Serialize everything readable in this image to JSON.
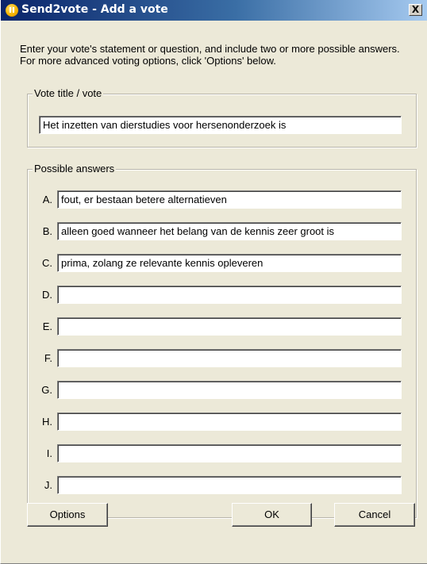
{
  "window": {
    "title": "Send2vote - Add a vote",
    "close_label": "X"
  },
  "intro_text": "Enter your vote's statement or question, and include two or more possible answers. For more advanced voting options, click 'Options' below.",
  "vote_title_group": {
    "legend": "Vote title / vote",
    "value": "Het inzetten van dierstudies voor hersenonderzoek is"
  },
  "answers_group": {
    "legend": "Possible answers",
    "items": [
      {
        "letter": "A.",
        "value": " fout, er bestaan betere alternatieven"
      },
      {
        "letter": "B.",
        "value": "alleen goed wanneer het belang van de kennis zeer groot is"
      },
      {
        "letter": "C.",
        "value": "prima, zolang ze relevante kennis opleveren"
      },
      {
        "letter": "D.",
        "value": ""
      },
      {
        "letter": "E.",
        "value": ""
      },
      {
        "letter": "F.",
        "value": ""
      },
      {
        "letter": "G.",
        "value": ""
      },
      {
        "letter": "H.",
        "value": ""
      },
      {
        "letter": "I.",
        "value": ""
      },
      {
        "letter": "J.",
        "value": ""
      }
    ]
  },
  "buttons": {
    "options": "Options",
    "ok": "OK",
    "cancel": "Cancel"
  }
}
